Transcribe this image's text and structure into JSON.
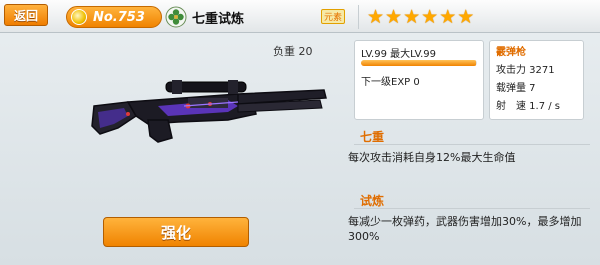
{
  "topbar": {
    "back_label": "返回",
    "number": "No.753",
    "weapon_name": "七重试炼",
    "element_badge": "元素",
    "stars": [
      "★",
      "★",
      "★",
      "★",
      "★",
      "★"
    ],
    "star_count": 6
  },
  "weapon": {
    "weight_label": "负重 20",
    "upgrade_label": "强化"
  },
  "level": {
    "level_text": "LV.99 最大LV.99",
    "exp_progress": 0.99,
    "next_exp_text": "下一级EXP 0"
  },
  "stats": {
    "type": "霰弹枪",
    "attack": "攻击力 3271",
    "ammo": "载弹量 7",
    "rate": "射　速 1.7 / s"
  },
  "skills": [
    {
      "title": "七重",
      "description": "每次攻击消耗自身12%最大生命值"
    },
    {
      "title": "试炼",
      "description": "每减少一枚弹药，武器伤害增加30%，最多增加300%"
    }
  ],
  "colors": {
    "accent": "#f08300",
    "star": "#ffa800",
    "section_title": "#e06d00"
  }
}
